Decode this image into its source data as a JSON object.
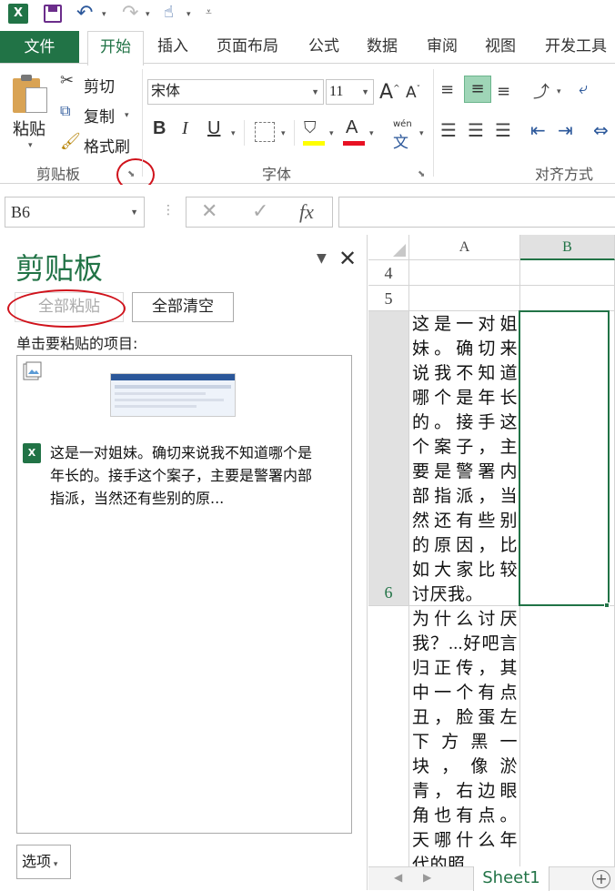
{
  "qat": {
    "app_icon": "X",
    "icons": [
      "excel-icon",
      "save-icon",
      "undo-icon",
      "redo-icon",
      "touch-mode-icon",
      "customize-icon"
    ]
  },
  "tabs": {
    "file": "文件",
    "items": [
      "开始",
      "插入",
      "页面布局",
      "公式",
      "数据",
      "审阅",
      "视图",
      "开发工具"
    ],
    "active": "开始"
  },
  "ribbon": {
    "clipboard": {
      "paste": "粘贴",
      "cut": "剪切",
      "copy": "复制",
      "format_painter": "格式刷",
      "group_label": "剪贴板"
    },
    "font": {
      "font_name": "宋体",
      "font_size": "11",
      "grow": "A",
      "shrink": "A",
      "bold": "B",
      "italic": "I",
      "underline": "U",
      "font_color_letter": "A",
      "phonetic_top": "wén",
      "phonetic_bottom": "文",
      "group_label": "字体"
    },
    "alignment": {
      "group_label": "对齐方式"
    },
    "colors": {
      "accent": "#217346",
      "font_color_bar": "#e81123",
      "fill_color_bar": "#ffff00",
      "annotation": "#d0121b"
    }
  },
  "formula_bar": {
    "name_box": "B6",
    "cancel": "✕",
    "enter": "✓",
    "fx": "fx",
    "value": ""
  },
  "clipboard_pane": {
    "title": "剪贴板",
    "paste_all": "全部粘贴",
    "clear_all": "全部清空",
    "hint": "单击要粘贴的项目:",
    "items": [
      {
        "type": "image",
        "icon": "picture-icon"
      },
      {
        "type": "excel-text",
        "icon": "excel-icon",
        "text": "这是一对姐妹。确切来说我不知道哪个是年长的。接手这个案子，主要是警署内部指派，当然还有些别的原..."
      }
    ],
    "options": "选项"
  },
  "grid": {
    "columns": [
      "A",
      "B"
    ],
    "selected_column": "B",
    "rows": [
      {
        "num": "4",
        "a": ""
      },
      {
        "num": "5",
        "a": ""
      },
      {
        "num": "6",
        "a": "这是一对姐妹。确切来说我不知道哪个是年长的。接手这个案子，主要是警署内部指派，当然还有些别的原因，比如大家比较讨厌我。",
        "selected": true
      },
      {
        "num": "",
        "a": "为什么讨厌我？...好吧言归正传，其中一个有点丑，脸蛋左下方黑一块，像淤青，右边眼角也有点。天哪什么年代的照"
      }
    ]
  },
  "sheet_tabs": {
    "active": "Sheet1",
    "add_label": "+"
  }
}
